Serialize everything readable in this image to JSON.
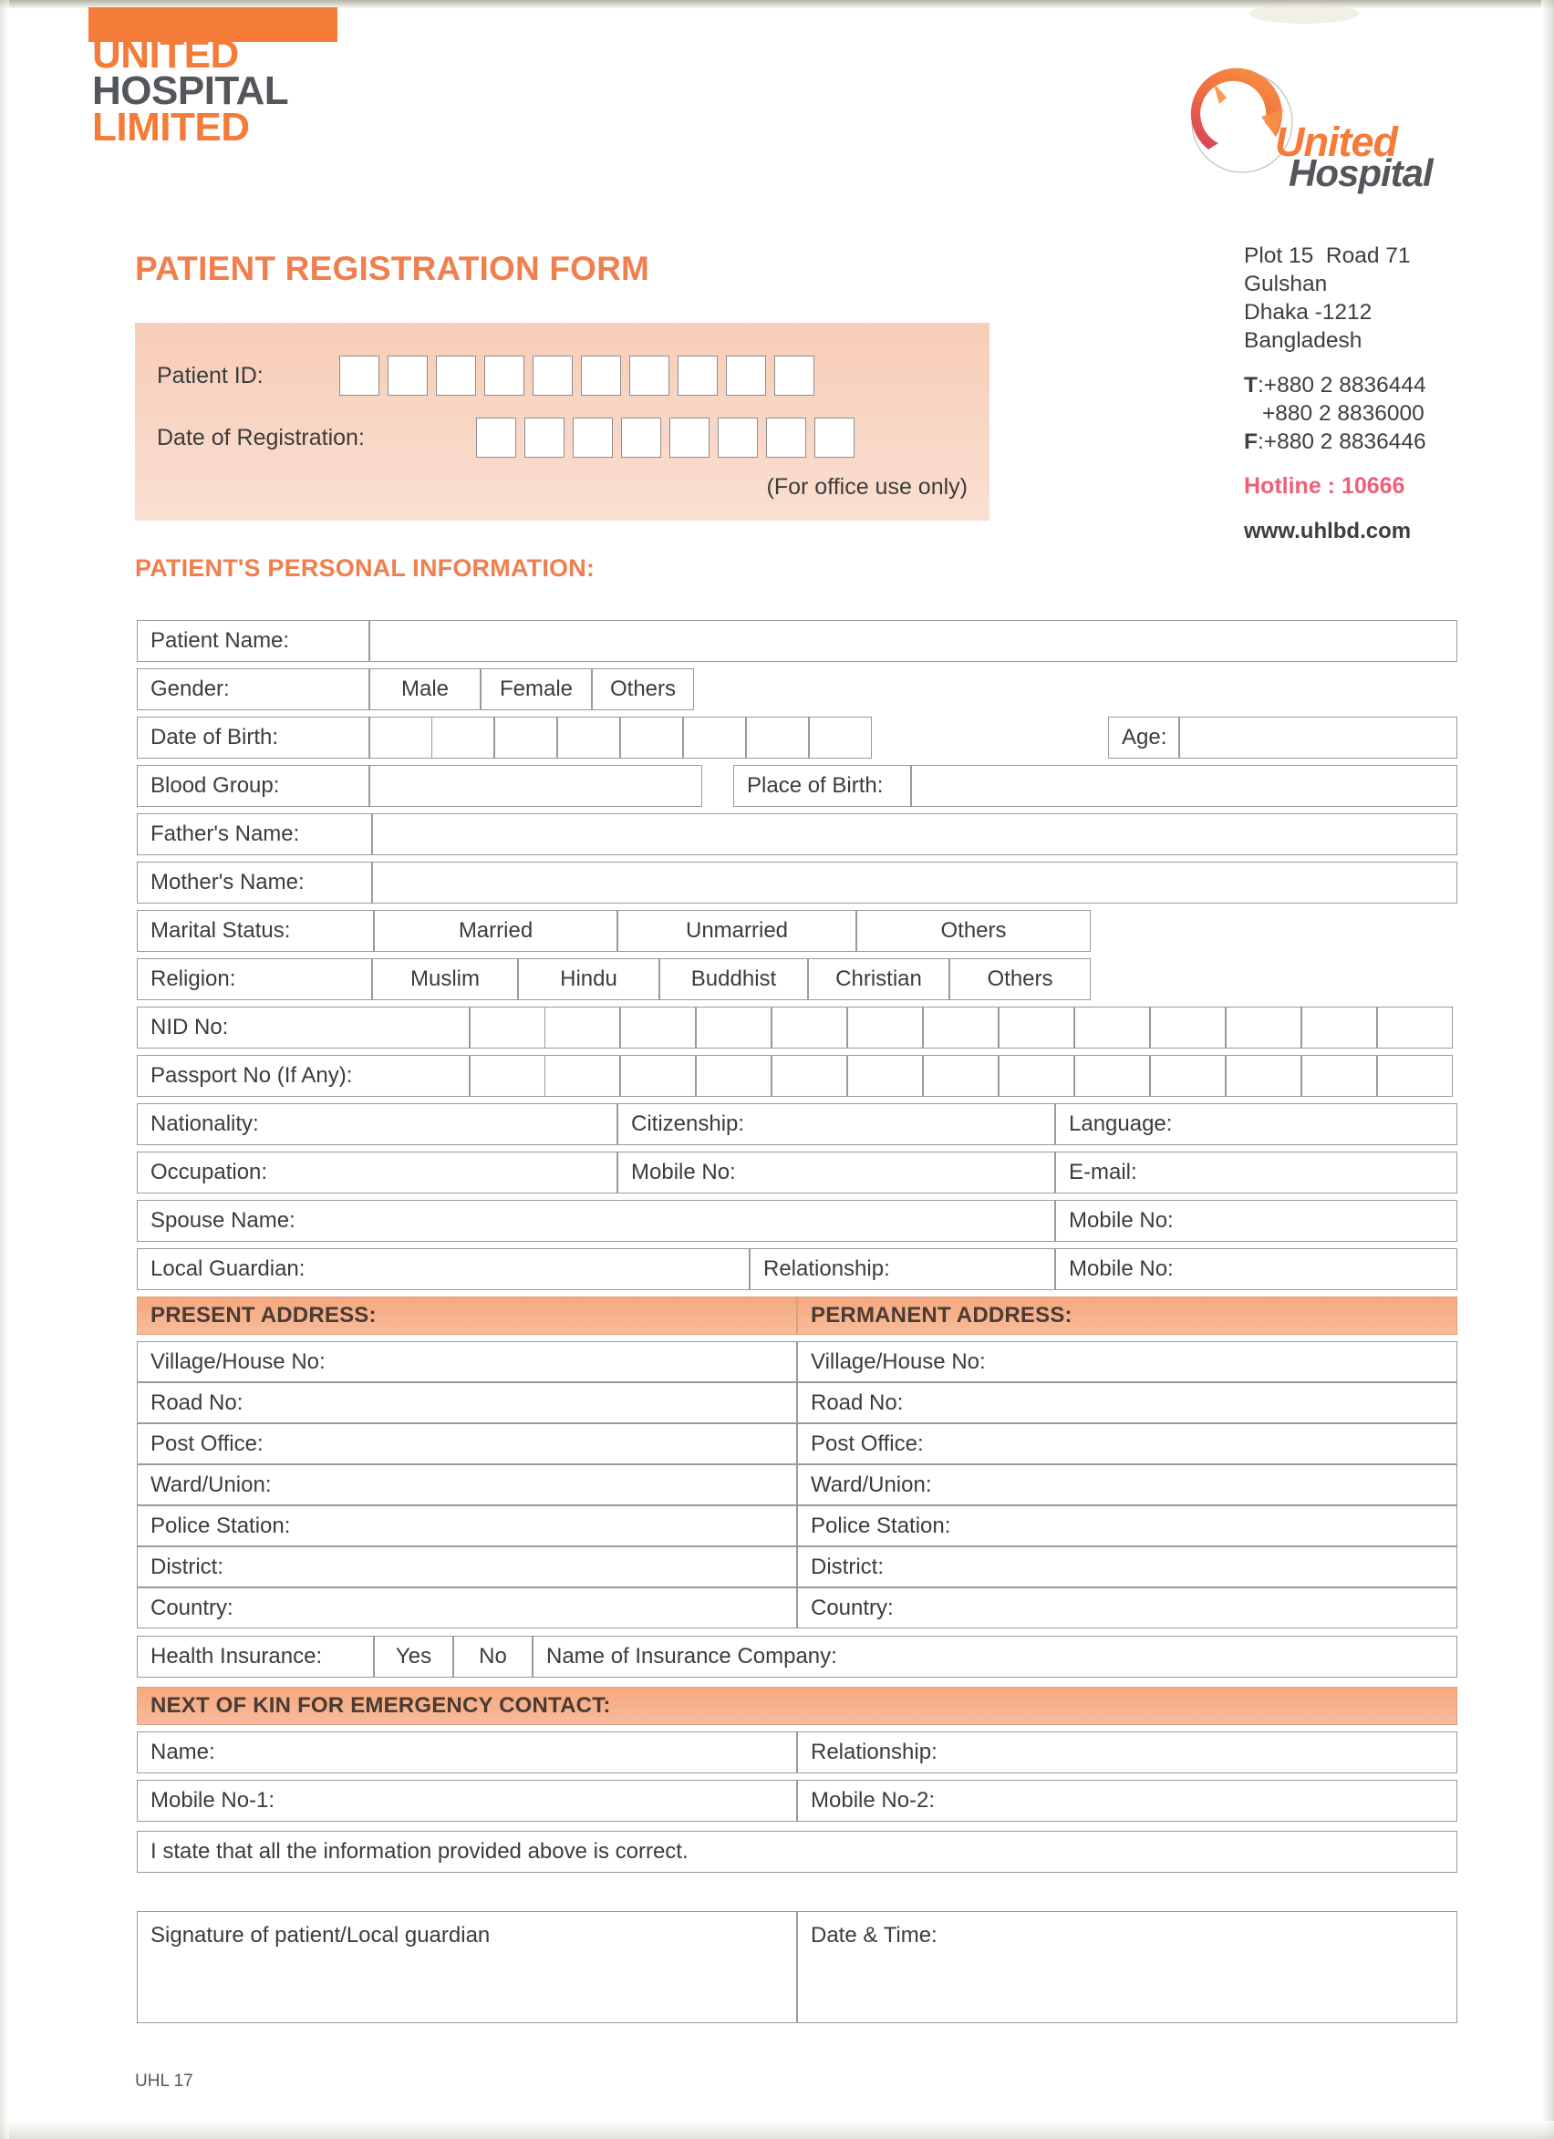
{
  "brand": {
    "line1": "UNITED",
    "line2": "HOSPITAL",
    "line3": "LIMITED",
    "logo_word_1": "United",
    "logo_word_2": "Hospital",
    "accent_orange": "#f47b38",
    "accent_gray": "#53565a",
    "hotline_color": "#ef5f7a",
    "band_color": "#f6a87e",
    "panel_color": "#f7cdb8"
  },
  "contact": {
    "address": [
      "Plot 15  Road 71",
      "Gulshan",
      "Dhaka -1212",
      "Bangladesh"
    ],
    "tel_label": "T",
    "tel_1": ":+880 2 8836444",
    "tel_2": "+880 2 8836000",
    "fax_label": "F",
    "fax": ":+880 2 8836446",
    "hotline": "Hotline : 10666",
    "website": "www.uhlbd.com"
  },
  "title": "PATIENT REGISTRATION FORM",
  "id_panel": {
    "patient_id_label": "Patient ID:",
    "patient_id_boxes": 10,
    "date_of_registration_label": "Date of Registration:",
    "date_of_registration_boxes": 8,
    "office_note": "(For office use only)"
  },
  "personal_heading": "PATIENT'S PERSONAL INFORMATION:",
  "rows": {
    "patient_name": "Patient Name:",
    "gender": "Gender:",
    "gender_options": [
      "Male",
      "Female",
      "Others"
    ],
    "date_of_birth": "Date of Birth:",
    "date_of_birth_boxes": 8,
    "age": "Age:",
    "blood_group": "Blood Group:",
    "place_of_birth": "Place of Birth:",
    "fathers_name": "Father's Name:",
    "mothers_name": "Mother's Name:",
    "marital_status": "Marital Status:",
    "marital_options": [
      "Married",
      "Unmarried",
      "Others"
    ],
    "religion": "Religion:",
    "religion_options": [
      "Muslim",
      "Hindu",
      "Buddhist",
      "Christian",
      "Others"
    ],
    "nid_no": "NID No:",
    "nid_boxes": 13,
    "passport_no": "Passport No (If Any):",
    "passport_boxes": 13,
    "nationality": "Nationality:",
    "citizenship": "Citizenship:",
    "language": "Language:",
    "occupation": "Occupation:",
    "mobile_no": "Mobile No:",
    "email": "E-mail:",
    "spouse_name": "Spouse Name:",
    "spouse_mobile": "Mobile No:",
    "local_guardian": "Local Guardian:",
    "guardian_relationship": "Relationship:",
    "guardian_mobile": "Mobile No:"
  },
  "present_address": {
    "heading": "PRESENT ADDRESS:",
    "fields": [
      "Village/House No:",
      "Road No:",
      "Post Office:",
      "Ward/Union:",
      "Police Station:",
      "District:",
      "Country:"
    ]
  },
  "permanent_address": {
    "heading": "PERMANENT ADDRESS:",
    "fields": [
      "Village/House No:",
      "Road No:",
      "Post Office:",
      "Ward/Union:",
      "Police Station:",
      "District:",
      "Country:"
    ]
  },
  "insurance": {
    "label": "Health Insurance:",
    "yes": "Yes",
    "no": "No",
    "company_label": "Name of Insurance Company:"
  },
  "next_of_kin": {
    "heading": "NEXT OF KIN FOR EMERGENCY CONTACT:",
    "name": "Name:",
    "relationship": "Relationship:",
    "mobile_1": "Mobile No-1:",
    "mobile_2": "Mobile No-2:"
  },
  "declaration": "I state that all the information provided above is correct.",
  "signature": {
    "signature_label": "Signature of patient/Local guardian",
    "date_time_label": "Date & Time:"
  },
  "footer_code": "UHL 17"
}
